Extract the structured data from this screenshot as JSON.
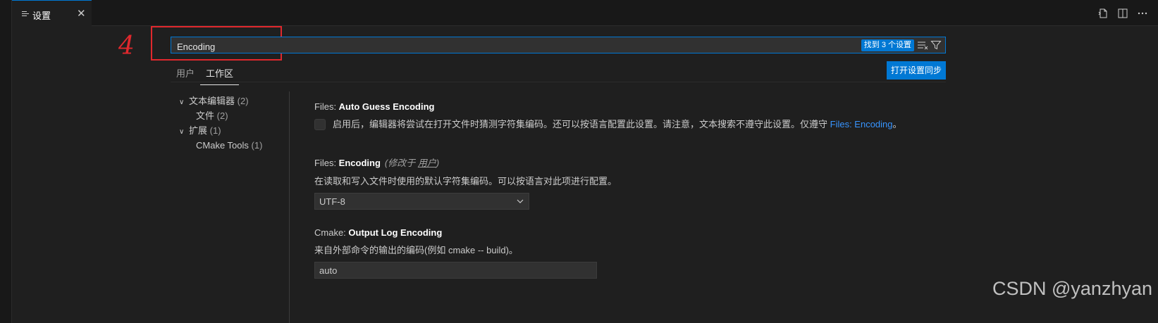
{
  "tab": {
    "title": "设置",
    "close": "✕"
  },
  "annotation": {
    "number": "4"
  },
  "search": {
    "value": "Encoding",
    "result_count": "找到 3 个设置"
  },
  "scope_tabs": [
    "用户",
    "工作区"
  ],
  "sync_button": "打开设置同步",
  "toc": [
    {
      "label": "文本编辑器",
      "count": "(2)"
    },
    {
      "label": "文件",
      "count": "(2)"
    },
    {
      "label": "扩展",
      "count": "(1)"
    },
    {
      "label": "CMake Tools",
      "count": "(1)"
    }
  ],
  "settings": {
    "auto_guess": {
      "category": "Files: ",
      "name": "Auto Guess Encoding",
      "description": "启用后，编辑器将尝试在打开文件时猜测字符集编码。还可以按语言配置此设置。请注意，文本搜索不遵守此设置。仅遵守 ",
      "link": "Files: Encoding",
      "suffix": "。"
    },
    "encoding": {
      "category": "Files: ",
      "name": "Encoding",
      "modified_prefix": "(修改于 ",
      "modified_link": "用户",
      "modified_suffix": ")",
      "description": "在读取和写入文件时使用的默认字符集编码。可以按语言对此项进行配置。",
      "value": "UTF-8"
    },
    "cmake_output": {
      "category": "Cmake: ",
      "name": "Output Log Encoding",
      "description": "来自外部命令的输出的编码(例如 cmake -- build)。",
      "value": "auto"
    }
  },
  "watermark": "CSDN @yanzhyan",
  "colors": {
    "accent": "#0078d4",
    "annotation": "#e0282d",
    "link": "#3794ff"
  }
}
